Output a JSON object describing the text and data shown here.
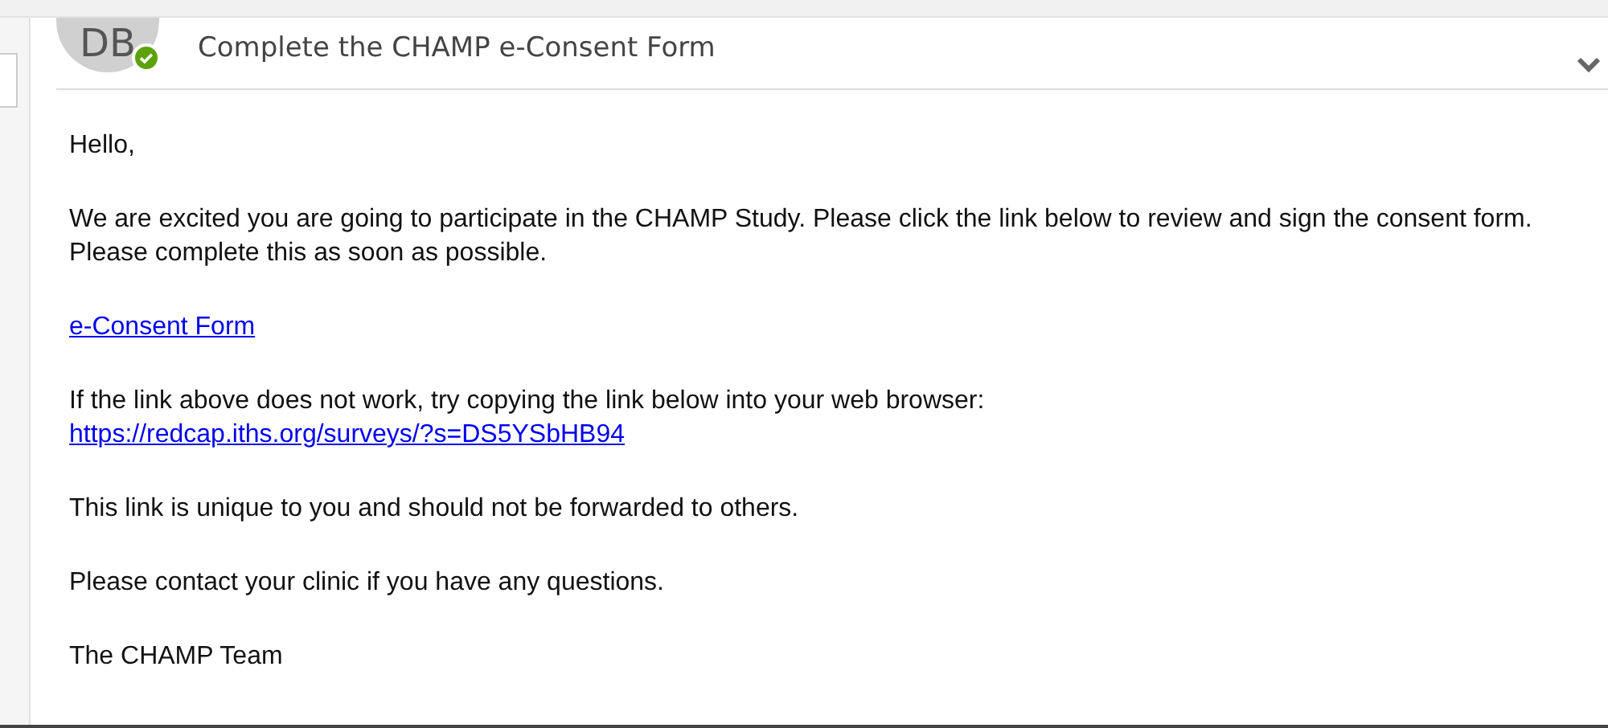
{
  "sender": {
    "initials": "DB",
    "online": true
  },
  "subject": "Complete the CHAMP e-Consent Form",
  "body": [
    {
      "kind": "text",
      "text": "Hello,"
    },
    {
      "kind": "text",
      "text": "We are excited you are going to participate in the CHAMP Study. Please click the link below to review and sign the consent form. Please complete this as soon as possible."
    },
    {
      "kind": "link",
      "text": "e-Consent Form"
    },
    {
      "kind": "textlink",
      "text": "If the link above does not work, try copying the link below into your web browser:",
      "link": "https://redcap.iths.org/surveys/?s=DS5YSbHB94"
    },
    {
      "kind": "text",
      "text": "This link is unique to you and should not be forwarded to others."
    },
    {
      "kind": "text",
      "text": "Please contact your clinic if you have any questions."
    },
    {
      "kind": "text",
      "text": "The CHAMP Team"
    }
  ]
}
